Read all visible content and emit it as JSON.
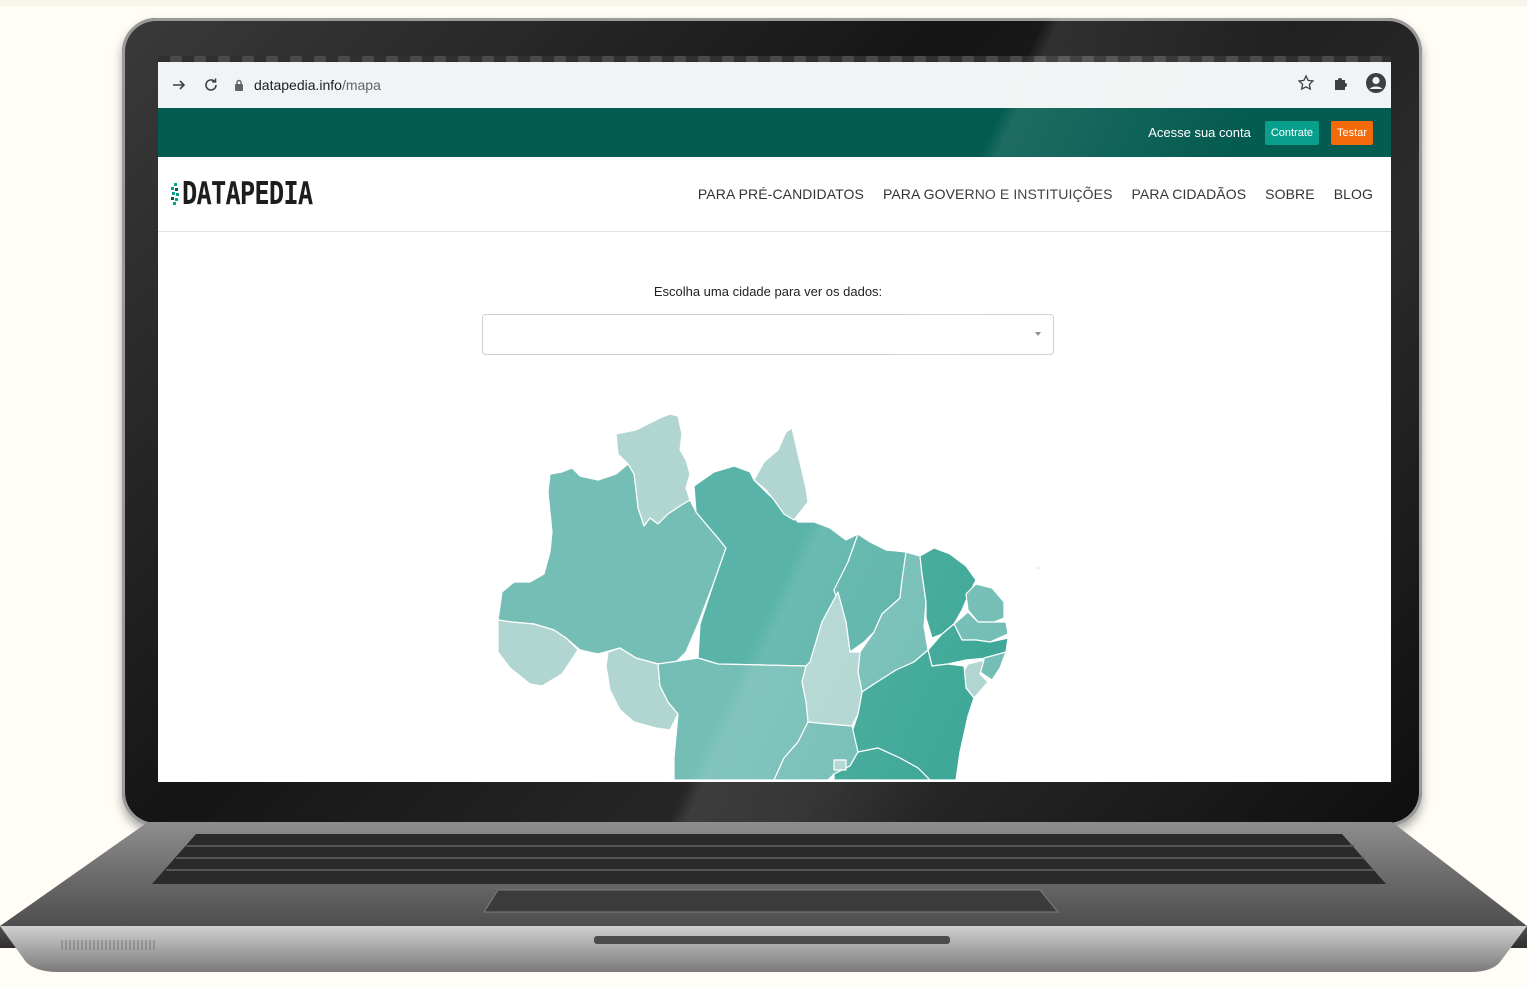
{
  "browser": {
    "url_domain": "datapedia.info",
    "url_path": "/mapa"
  },
  "site": {
    "top_bar": {
      "account_link": "Acesse sua conta",
      "contrate_button": "Contrate",
      "testar_button": "Testar",
      "colors": {
        "bar": "#045b50",
        "contrate": "#08a08c",
        "testar": "#f26a0a"
      }
    },
    "logo_text": "DATAPEDIA",
    "nav": [
      "PARA PRÉ-CANDIDATOS",
      "PARA GOVERNO E INSTITUIÇÕES",
      "PARA CIDADÃOS",
      "SOBRE",
      "BLOG"
    ],
    "main": {
      "prompt": "Escolha uma cidade para ver os dados:",
      "city_select_value": ""
    },
    "map": {
      "colors": [
        "#b1d6d2",
        "#74beb6",
        "#5ab3a9",
        "#3fa898"
      ]
    }
  }
}
